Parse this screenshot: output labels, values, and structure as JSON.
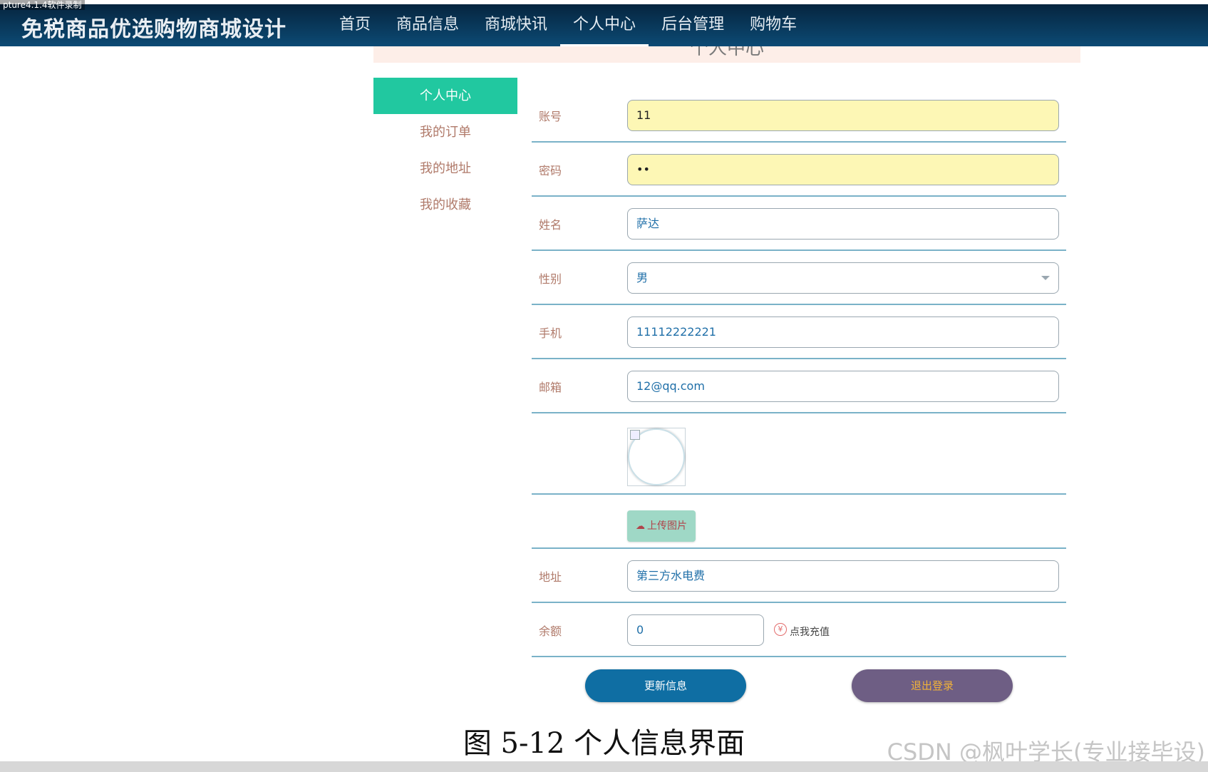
{
  "recorder_watermark": "pture4.1.4软件录制",
  "header": {
    "site_title": "免税商品优选购物商城设计",
    "nav": [
      {
        "label": "首页"
      },
      {
        "label": "商品信息"
      },
      {
        "label": "商城快讯"
      },
      {
        "label": "个人中心",
        "active": true
      },
      {
        "label": "后台管理"
      },
      {
        "label": "购物车"
      }
    ]
  },
  "page_heading": "个人中心",
  "sidebar": {
    "items": [
      {
        "label": "个人中心",
        "active": true
      },
      {
        "label": "我的订单"
      },
      {
        "label": "我的地址"
      },
      {
        "label": "我的收藏"
      }
    ]
  },
  "form": {
    "account": {
      "label": "账号",
      "value": "11"
    },
    "password": {
      "label": "密码",
      "value": "••"
    },
    "name": {
      "label": "姓名",
      "value": "萨达"
    },
    "gender": {
      "label": "性别",
      "value": "男"
    },
    "phone": {
      "label": "手机",
      "value": "11112222221"
    },
    "email": {
      "label": "邮箱",
      "value": "12@qq.com"
    },
    "upload_label": "上传图片",
    "address": {
      "label": "地址",
      "value": "第三方水电费"
    },
    "balance": {
      "label": "余额",
      "value": "0"
    },
    "recharge_text": "点我充值",
    "recharge_icon": "¥"
  },
  "actions": {
    "update": "更新信息",
    "logout": "退出登录"
  },
  "caption": "图 5-12 个人信息界面",
  "csdn_watermark": "CSDN @枫叶学长(专业接毕设)",
  "colors": {
    "header_bg": "#0c4a74",
    "sidebar_active": "#21c8a0",
    "update_button": "#0f6ea3",
    "logout_button": "#6e5e84"
  }
}
